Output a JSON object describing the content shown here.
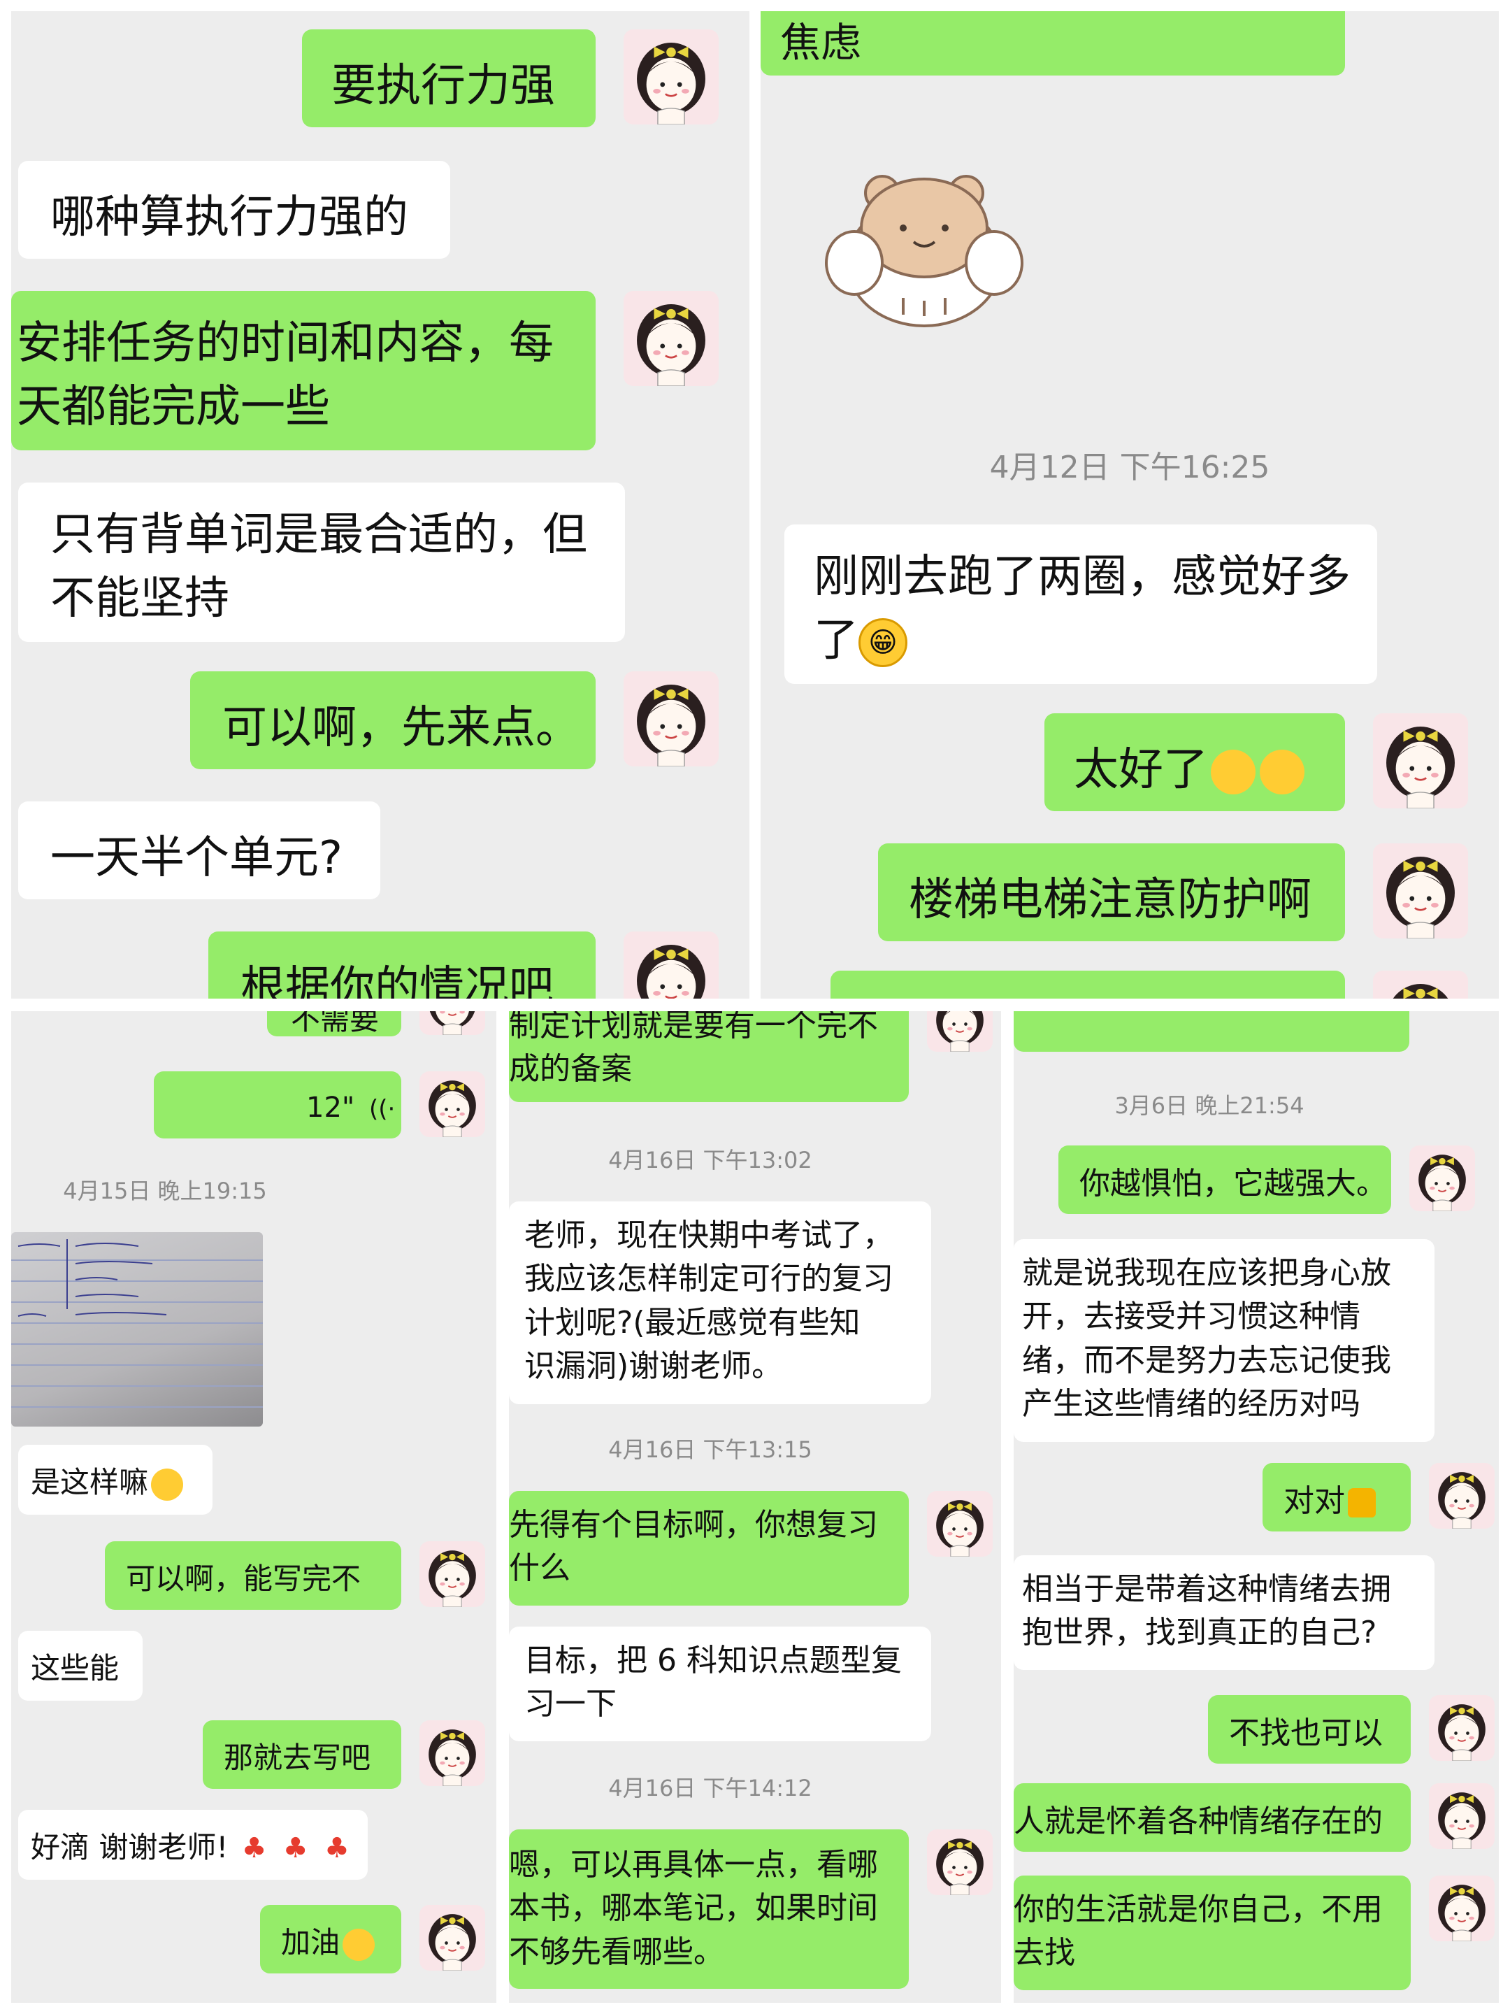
{
  "p1": {
    "m1": "要执行力强",
    "m2": "哪种算执行力强的",
    "m3a": "安排任务的时间和内容，每",
    "m3b": "天都能完成一些",
    "m4a": "只有背单词是最合适的，但",
    "m4b": "不能坚持",
    "m5": "可以啊，先来点。",
    "m6": "一天半个单元?",
    "m7": "根据你的情况吧"
  },
  "p2": {
    "m0": "焦虑",
    "ts1": "4月12日 下午16:25",
    "m1a": "刚刚去跑了两圈，感觉好多",
    "m1b": "了",
    "m2": "太好了",
    "m3": "楼梯电梯注意防护啊"
  },
  "p3": {
    "m0": "不需要",
    "voice": "12\"",
    "ts1": "4月15日 晚上19:15",
    "m1": "是这样嘛",
    "m2": "可以啊，能写完不",
    "m3": "这些能",
    "m4": "那就去写吧",
    "m5": "好滴 谢谢老师!",
    "m6": "加油"
  },
  "p4": {
    "m0a": "制定计划就是要有一个完不",
    "m0b": "成的备案",
    "ts1": "4月16日 下午13:02",
    "m1a": "老师，现在快期中考试了，",
    "m1b": "我应该怎样制定可行的复习",
    "m1c": "计划呢?(最近感觉有些知",
    "m1d": "识漏洞)谢谢老师。",
    "ts2": "4月16日 下午13:15",
    "m2a": "先得有个目标啊，你想复习",
    "m2b": "什么",
    "m3a": "目标，把 6 科知识点题型复",
    "m3b": "习一下",
    "ts3": "4月16日 下午14:12",
    "m4a": "嗯，可以再具体一点，看哪",
    "m4b": "本书，哪本笔记，如果时间",
    "m4c": "不够先看哪些。"
  },
  "p5": {
    "ts1": "3月6日 晚上21:54",
    "m1": "你越惧怕，它越强大。",
    "m2a": "就是说我现在应该把身心放",
    "m2b": "开，去接受并习惯这种情",
    "m2c": "绪，而不是努力去忘记使我",
    "m2d": "产生这些情绪的经历对吗",
    "m3": "对对",
    "m4a": "相当于是带着这种情绪去拥",
    "m4b": "抱世界，找到真正的自己?",
    "m5": "不找也可以",
    "m6": "人就是怀着各种情绪存在的",
    "m7a": "你的生活就是你自己，不用",
    "m7b": "去找"
  },
  "colors": {
    "me": "#95ec69",
    "them": "#ffffff",
    "bg": "#ededed",
    "avatar_bg": "#f9e5e8"
  }
}
